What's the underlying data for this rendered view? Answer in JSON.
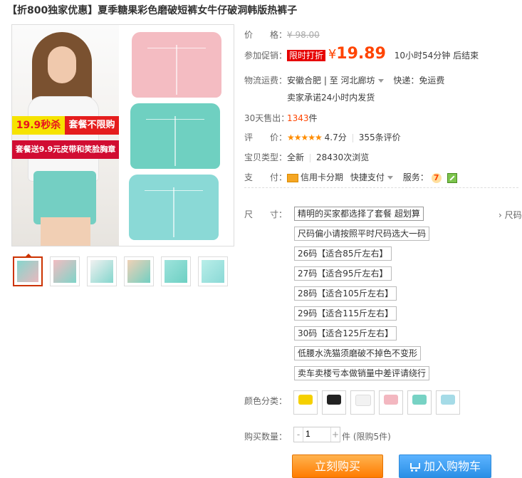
{
  "page": {
    "title": "【折800独家优惠】夏季糖果彩色磨破短裤女牛仔破洞韩版热裤子"
  },
  "gallery": {
    "badge_left": "19.9秒杀",
    "badge_right": "套餐不限购",
    "badge_bottom": "套餐送9.9元皮带和笑脸胸章",
    "thumbnails": [
      "thumb-1",
      "thumb-2",
      "thumb-3",
      "thumb-4",
      "thumb-5",
      "thumb-6"
    ]
  },
  "pricing": {
    "price_label": "价　　格：",
    "original_price": "¥ 98.00",
    "promo_label": "参加促销：",
    "promo_tag": "限时打折",
    "promo_price_currency": "¥",
    "promo_price": "19.89",
    "countdown": "10小时54分钟 后结束"
  },
  "logistics": {
    "label": "物流运费：",
    "from": "安徽合肥",
    "to": "河北廊坊",
    "shipping": "快递：免运费",
    "promise": "卖家承诺24小时内发货"
  },
  "sales": {
    "label": "30天售出：",
    "count": "1343",
    "unit": "件"
  },
  "review": {
    "label": "评　　价：",
    "stars": "★★★★★",
    "score": "4.7分",
    "count": "355条评价"
  },
  "item_type": {
    "label": "宝贝类型：",
    "new": "全新",
    "views": "28430次浏览"
  },
  "payment": {
    "label": "支　　付：",
    "credit": "信用卡分期",
    "quick": "快捷支付",
    "service_label": "服务：",
    "service_7": "7"
  },
  "sizes": {
    "label": "尺　　寸：",
    "right_link": "› 尺码",
    "options": [
      "精明的买家都选择了套餐 超划算",
      "尺码偏小请按照平时尺码选大一码",
      "26码【适合85斤左右】",
      "27码【适合95斤左右】",
      "28码【适合105斤左右】",
      "29码【适合115斤左右】",
      "30码【适合125斤左右】",
      "低腰水洗猫须磨破不掉色不变形",
      "卖车卖楼亏本做销量中差评请绕行"
    ]
  },
  "colors": {
    "label": "颜色分类：",
    "swatches": [
      {
        "color": "#f5d000",
        "name": "yellow"
      },
      {
        "color": "#222222",
        "name": "black"
      },
      {
        "color": "#f2f2f2",
        "name": "white"
      },
      {
        "color": "#f3b7c0",
        "name": "pink"
      },
      {
        "color": "#77d2c4",
        "name": "mint"
      },
      {
        "color": "#a5dbe7",
        "name": "light-blue"
      }
    ]
  },
  "quantity": {
    "label": "购买数量：",
    "value": "1",
    "minus": "-",
    "plus": "+",
    "limit": "件 (限购5件)"
  },
  "actions": {
    "buy": "立刻购买",
    "cart": "加入购物车"
  }
}
